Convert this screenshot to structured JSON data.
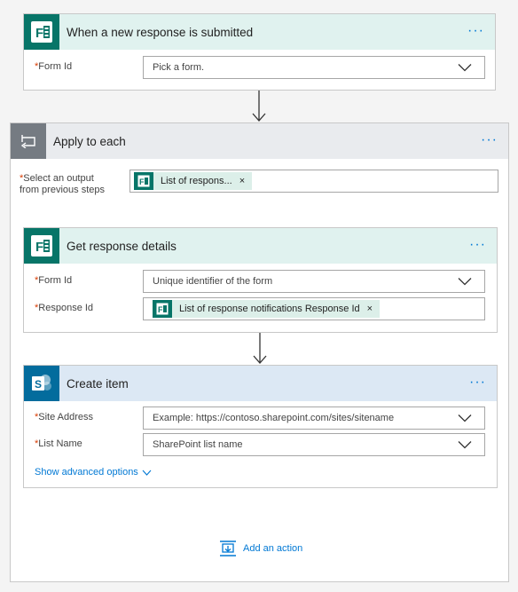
{
  "trigger": {
    "title": "When a new response is submitted",
    "more": "···",
    "fields": [
      {
        "label": "Form Id",
        "value": "Pick a form."
      }
    ]
  },
  "apply_each": {
    "title": "Apply to each",
    "more": "···",
    "select_label": "Select an output from previous steps",
    "select_label_line1": "Select an output",
    "select_label_line2": "from previous steps",
    "select_token": "List of respons...",
    "token_remove": "×"
  },
  "get_details": {
    "title": "Get response details",
    "more": "···",
    "fields": [
      {
        "label": "Form Id",
        "value": "Unique identifier of the form"
      },
      {
        "label": "Response Id",
        "token": "List of response notifications Response Id",
        "token_remove": "×"
      }
    ]
  },
  "create_item": {
    "title": "Create item",
    "more": "···",
    "fields": [
      {
        "label": "Site Address",
        "value": "Example: https://contoso.sharepoint.com/sites/sitename"
      },
      {
        "label": "List Name",
        "value": "SharePoint list name"
      }
    ],
    "advanced_link": "Show advanced options"
  },
  "add_action": {
    "label": "Add an action"
  },
  "colors": {
    "forms_green": "#077568",
    "forms_header_bg": "#e0f2ef",
    "loop_header_bg": "#e9ebee",
    "sharepoint_blue": "#036c9d",
    "sp_header_bg": "#dce8f4",
    "accent": "#0078d4",
    "required": "#d83b01"
  },
  "icons": [
    "forms-icon",
    "loop-icon",
    "sharepoint-icon",
    "chevron-down-icon",
    "more-icon",
    "arrow-down-icon",
    "add-action-icon"
  ]
}
